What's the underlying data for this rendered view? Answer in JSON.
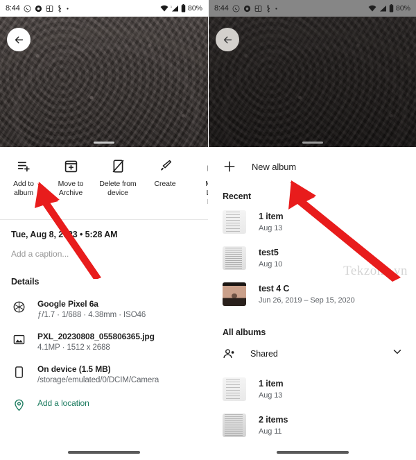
{
  "statusbar": {
    "time": "8:44",
    "battery": "80%",
    "icons": [
      "whatsapp-icon",
      "record-icon",
      "screenshot-icon",
      "bluetooth-icon",
      "dot-icon"
    ],
    "right_icons": [
      "wifi-icon",
      "signal-icon",
      "battery-icon"
    ]
  },
  "left_screen": {
    "back_label": "back-arrow",
    "actions": [
      {
        "icon": "playlist-add-icon",
        "label_line1": "Add to",
        "label_line2": "album"
      },
      {
        "icon": "archive-icon",
        "label_line1": "Move to",
        "label_line2": "Archive"
      },
      {
        "icon": "delete-device-icon",
        "label_line1": "Delete from",
        "label_line2": "device"
      },
      {
        "icon": "brush-icon",
        "label_line1": "Create",
        "label_line2": ""
      },
      {
        "icon": "locked-folder-icon",
        "label_line1": "Mov",
        "label_line2": "Loc",
        "label_line3": "Fol"
      }
    ],
    "datetime": "Tue, Aug 8, 2023  •  5:28 AM",
    "caption_placeholder": "Add a caption...",
    "details_title": "Details",
    "details": [
      {
        "icon": "aperture-icon",
        "title": "Google Pixel 6a",
        "subtitle": "ƒ/1.7  ·  1/688  ·  4.38mm  ·  ISO46"
      },
      {
        "icon": "image-icon",
        "title": "PXL_20230808_055806365.jpg",
        "subtitle": "4.1MP  ·  1512 x 2688"
      },
      {
        "icon": "phone-icon",
        "title": "On device (1.5 MB)",
        "subtitle": "/storage/emulated/0/DCIM/Camera"
      }
    ],
    "add_location": "Add a location",
    "add_location_icon": "location-pin-icon"
  },
  "right_screen": {
    "back_label": "back-arrow",
    "new_album": {
      "icon": "plus-icon",
      "label": "New album"
    },
    "recent_title": "Recent",
    "recent_albums": [
      {
        "thumb": "doc",
        "title": "1 item",
        "subtitle": "Aug 13"
      },
      {
        "thumb": "doc2",
        "title": "test5",
        "subtitle": "Aug 10"
      },
      {
        "thumb": "portrait",
        "title": "test 4 C",
        "subtitle": "Jun 26, 2019 – Sep 15, 2020"
      }
    ],
    "all_albums_title": "All albums",
    "shared": {
      "icon": "people-icon",
      "label": "Shared",
      "chevron": "chevron-down-icon"
    },
    "all_albums": [
      {
        "thumb": "doc",
        "title": "1 item",
        "subtitle": "Aug 13"
      },
      {
        "thumb": "doc3",
        "title": "2 items",
        "subtitle": "Aug 11"
      }
    ]
  },
  "watermark": "Tekzone.vn",
  "annotations": {
    "left_arrow_target": "Add to album",
    "right_arrow_target": "New album",
    "arrow_color": "#e81c1c"
  }
}
